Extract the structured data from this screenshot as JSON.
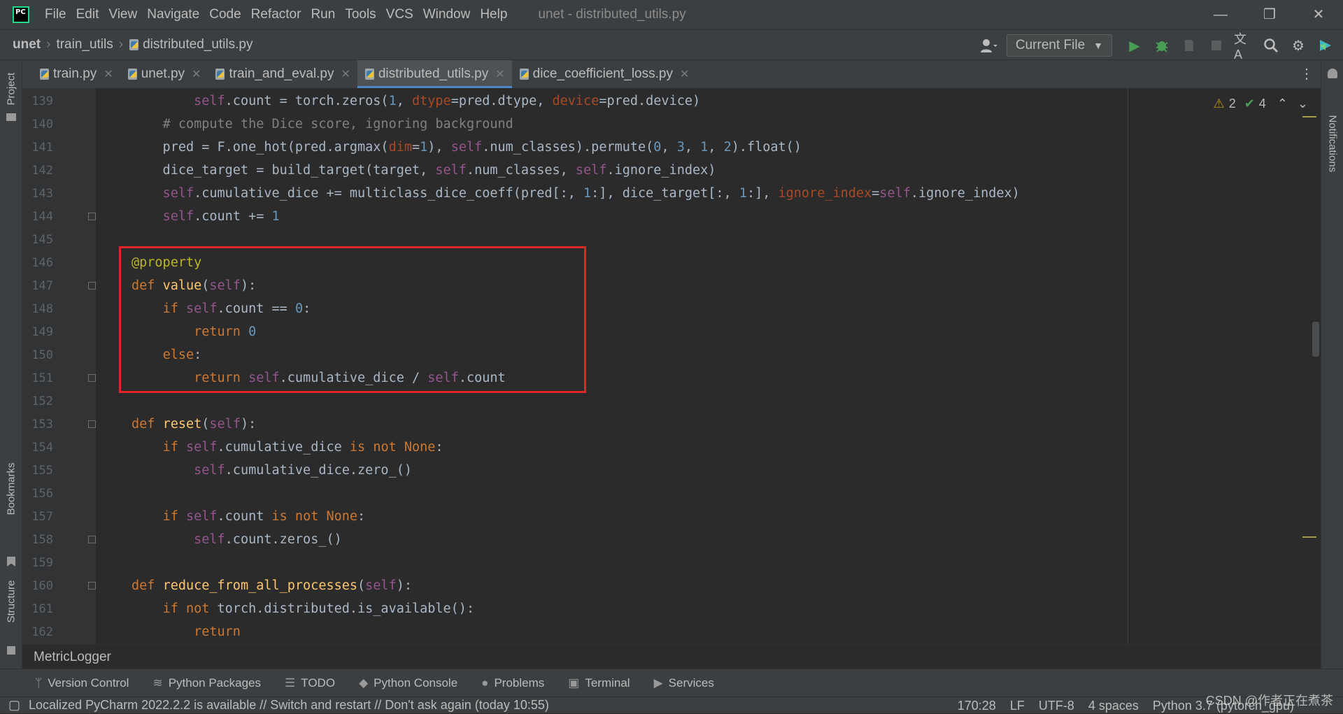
{
  "titlebar": {
    "menu": [
      "File",
      "Edit",
      "View",
      "Navigate",
      "Code",
      "Refactor",
      "Run",
      "Tools",
      "VCS",
      "Window",
      "Help"
    ],
    "title": "unet - distributed_utils.py",
    "minimize": "—",
    "restore": "❐",
    "close": "✕"
  },
  "navbar": {
    "project": "unet",
    "folder": "train_utils",
    "file": "distributed_utils.py",
    "run_config": "Current File"
  },
  "tabs": [
    {
      "label": "train.py"
    },
    {
      "label": "unet.py"
    },
    {
      "label": "train_and_eval.py"
    },
    {
      "label": "distributed_utils.py"
    },
    {
      "label": "dice_coefficient_loss.py"
    }
  ],
  "side_tabs": {
    "project": "Project",
    "bookmarks": "Bookmarks",
    "structure": "Structure",
    "notifications": "Notifications"
  },
  "inspections": {
    "warnings": "2",
    "ok": "4"
  },
  "editor": {
    "line_numbers": [
      "139",
      "140",
      "141",
      "142",
      "143",
      "144",
      "145",
      "146",
      "147",
      "148",
      "149",
      "150",
      "151",
      "152",
      "153",
      "154",
      "155",
      "156",
      "157",
      "158",
      "159",
      "160",
      "161",
      "162"
    ]
  },
  "bottom_breadcrumb": "MetricLogger",
  "tool_windows": [
    "Version Control",
    "Python Packages",
    "TODO",
    "Python Console",
    "Problems",
    "Terminal",
    "Services"
  ],
  "status": {
    "message": "Localized PyCharm 2022.2.2 is available // Switch and restart // Don't ask again (today 10:55)",
    "position": "170:28",
    "line_sep": "LF",
    "encoding": "UTF-8",
    "indent": "4 spaces",
    "interpreter": "Python 3.7 (pytorch_gpu)"
  },
  "watermark": "CSDN @作者正在煮茶"
}
